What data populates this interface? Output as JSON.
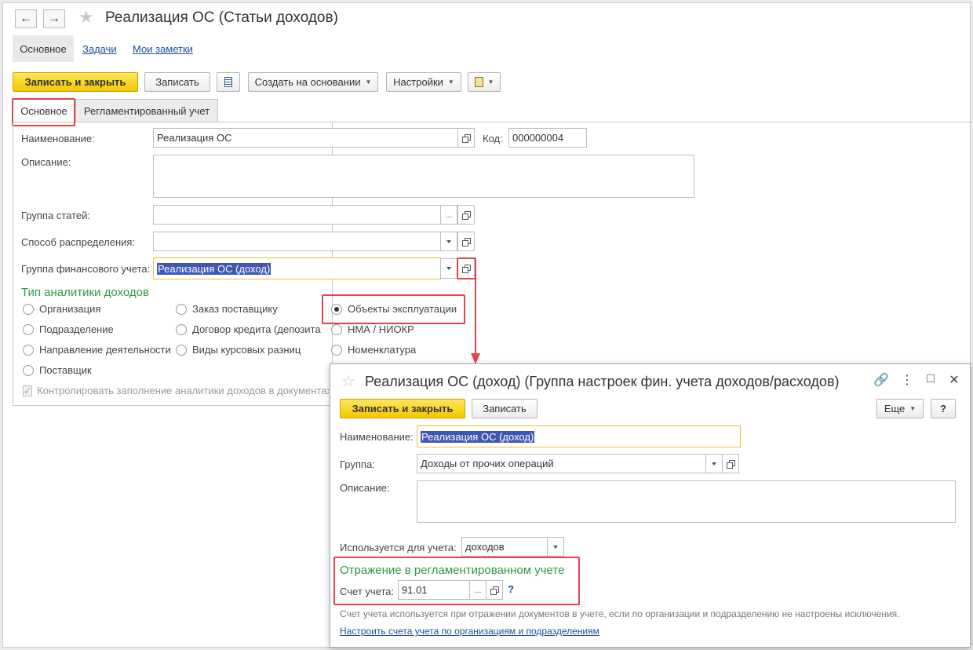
{
  "main": {
    "title": "Реализация ОС (Статьи доходов)",
    "nav_tabs": [
      "Основное",
      "Задачи",
      "Мои заметки"
    ],
    "toolbar": {
      "save_close": "Записать и закрыть",
      "save": "Записать",
      "create_based": "Создать на основании",
      "settings": "Настройки"
    },
    "form_tabs": [
      "Основное",
      "Регламентированный учет"
    ],
    "fields": {
      "name_label": "Наименование:",
      "name_value": "Реализация ОС",
      "code_label": "Код:",
      "code_value": "000000004",
      "description_label": "Описание:",
      "group_label": "Группа статей:",
      "distribution_label": "Способ распределения:",
      "fin_group_label": "Группа финансового учета:",
      "fin_group_value": "Реализация ОС (доход)"
    },
    "analytics": {
      "title": "Тип аналитики доходов",
      "options": [
        {
          "label": "Организация",
          "selected": false
        },
        {
          "label": "Подразделение",
          "selected": false
        },
        {
          "label": "Направление деятельности",
          "selected": false
        },
        {
          "label": "Поставщик",
          "selected": false
        },
        {
          "label": "Заказ поставщику",
          "selected": false
        },
        {
          "label": "Договор кредита (депозита",
          "selected": false
        },
        {
          "label": "Виды курсовых разниц",
          "selected": false
        },
        {
          "label": "Объекты эксплуатации",
          "selected": true
        },
        {
          "label": "НМА / НИОКР",
          "selected": false
        },
        {
          "label": "Номенклатура",
          "selected": false
        }
      ],
      "control_checkbox": "Контролировать заполнение аналитики доходов в документах"
    }
  },
  "popup": {
    "title": "Реализация ОС (доход) (Группа настроек фин. учета доходов/расходов)",
    "save_close": "Записать и закрыть",
    "save": "Записать",
    "more": "Еще",
    "help": "?",
    "name_label": "Наименование:",
    "name_value": "Реализация ОС (доход)",
    "group_label": "Группа:",
    "group_value": "Доходы от прочих операций",
    "description_label": "Описание:",
    "used_for_label": "Используется для учета:",
    "used_for_value": "доходов",
    "section_title": "Отражение в регламентированном учете",
    "account_label": "Счет учета:",
    "account_value": "91.01",
    "account_help": "?",
    "hint": "Счет учета используется при отражении документов в учете, если по организации и подразделению не настроены исключения.",
    "configure_link": "Настроить счета учета по организациям и подразделениям"
  }
}
